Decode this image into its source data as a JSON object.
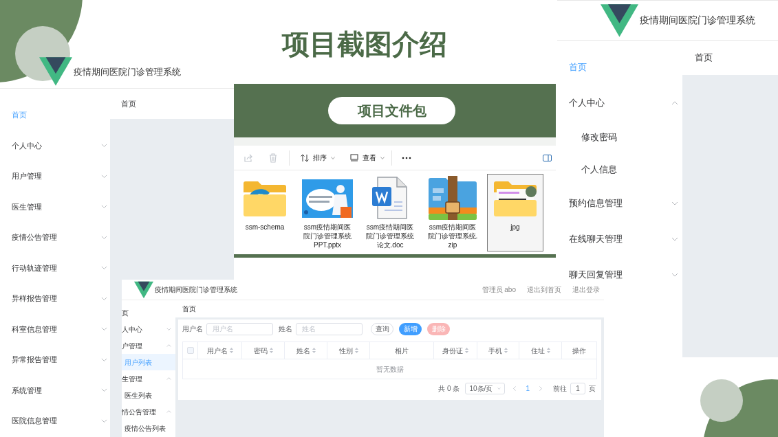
{
  "slide_title": "项目截图介绍",
  "screen_left": {
    "app_title": "疫情期间医院门诊管理系统",
    "breadcrumb": "首页",
    "menu": [
      {
        "label": "首页",
        "kind": "link",
        "selected": true
      },
      {
        "label": "个人中心",
        "kind": "group",
        "selected": false,
        "expanded": false
      },
      {
        "label": "用户管理",
        "kind": "group",
        "selected": false,
        "expanded": false
      },
      {
        "label": "医生管理",
        "kind": "group",
        "selected": false,
        "expanded": false
      },
      {
        "label": "疫情公告管理",
        "kind": "group",
        "selected": false,
        "expanded": false
      },
      {
        "label": "行动轨迹管理",
        "kind": "group",
        "selected": false,
        "expanded": false
      },
      {
        "label": "异样报告管理",
        "kind": "group",
        "selected": false,
        "expanded": false
      },
      {
        "label": "科室信息管理",
        "kind": "group",
        "selected": false,
        "expanded": false
      },
      {
        "label": "异常报告管理",
        "kind": "group",
        "selected": false,
        "expanded": false
      },
      {
        "label": "系统管理",
        "kind": "group",
        "selected": false,
        "expanded": false
      },
      {
        "label": "医院信息管理",
        "kind": "group",
        "selected": false,
        "expanded": false
      }
    ]
  },
  "file_panel": {
    "badge": "项目文件包",
    "actions": [
      {
        "kind": "share",
        "disabled": true
      },
      {
        "kind": "delete",
        "disabled": true
      }
    ],
    "sort_label": "排序",
    "view_label": "查看",
    "files": [
      {
        "name": "ssm-schema",
        "kind": "folder",
        "selected": false
      },
      {
        "name": "ssm疫情期间医院门诊管理系统PPT.pptx",
        "kind": "pptx",
        "selected": false
      },
      {
        "name": "ssm疫情期间医院门诊管理系统论文.doc",
        "kind": "doc",
        "selected": false
      },
      {
        "name": "ssm疫情期间医院门诊管理系统.zip",
        "kind": "zip",
        "selected": false
      },
      {
        "name": "jpg",
        "kind": "image-folder",
        "selected": true
      }
    ]
  },
  "screen_right": {
    "app_title": "疫情期间医院门诊管理系统",
    "breadcrumb": "首页",
    "menu": [
      {
        "label": "首页",
        "kind": "link",
        "selected": true
      },
      {
        "label": "个人中心",
        "kind": "group",
        "selected": false,
        "expanded": true,
        "children": [
          {
            "label": "修改密码",
            "selected": false
          },
          {
            "label": "个人信息",
            "selected": false
          }
        ]
      },
      {
        "label": "预约信息管理",
        "kind": "group",
        "selected": false,
        "expanded": false
      },
      {
        "label": "在线聊天管理",
        "kind": "group",
        "selected": false,
        "expanded": false
      },
      {
        "label": "聊天回复管理",
        "kind": "group",
        "selected": false,
        "expanded": false
      }
    ]
  },
  "screen_bottom": {
    "app_title": "疫情期间医院门诊管理系统",
    "header_links": [
      "管理员 abo",
      "退出到首页",
      "退出登录"
    ],
    "breadcrumb": "首页",
    "menu": [
      {
        "label": "页",
        "kind": "link",
        "selected": false
      },
      {
        "label": "人中心",
        "kind": "group",
        "selected": false,
        "expanded": false
      },
      {
        "label": "户管理",
        "kind": "group",
        "selected": false,
        "expanded": true,
        "children": [
          {
            "label": "用户列表",
            "selected": true
          }
        ]
      },
      {
        "label": "生管理",
        "kind": "group",
        "selected": false,
        "expanded": true,
        "children": [
          {
            "label": "医生列表",
            "selected": false
          }
        ]
      },
      {
        "label": "情公告管理",
        "kind": "group",
        "selected": false,
        "expanded": true,
        "children": [
          {
            "label": "疫情公告列表",
            "selected": false
          }
        ]
      }
    ],
    "search": [
      {
        "label": "用户名",
        "placeholder": "用户名"
      },
      {
        "label": "姓名",
        "placeholder": "姓名"
      }
    ],
    "buttons": [
      {
        "label": "查询",
        "kind": "default",
        "disabled": false
      },
      {
        "label": "新增",
        "kind": "primary",
        "disabled": false
      },
      {
        "label": "删除",
        "kind": "danger",
        "disabled": true
      }
    ],
    "select_all": {
      "checked": false
    },
    "columns": [
      {
        "label": "用户名",
        "sortable": true
      },
      {
        "label": "密码",
        "sortable": true
      },
      {
        "label": "姓名",
        "sortable": true
      },
      {
        "label": "性别",
        "sortable": true
      },
      {
        "label": "相片",
        "sortable": false
      },
      {
        "label": "身份证",
        "sortable": true
      },
      {
        "label": "手机",
        "sortable": true
      },
      {
        "label": "住址",
        "sortable": true
      },
      {
        "label": "操作",
        "sortable": false
      }
    ],
    "empty_text": "暂无数据",
    "pagination": {
      "total": "共 0 条",
      "page_size": "10条/页",
      "pages": [
        {
          "label": "1",
          "selected": true
        }
      ],
      "goto_label": "前往",
      "goto_value": "1",
      "goto_suffix": "页"
    }
  }
}
